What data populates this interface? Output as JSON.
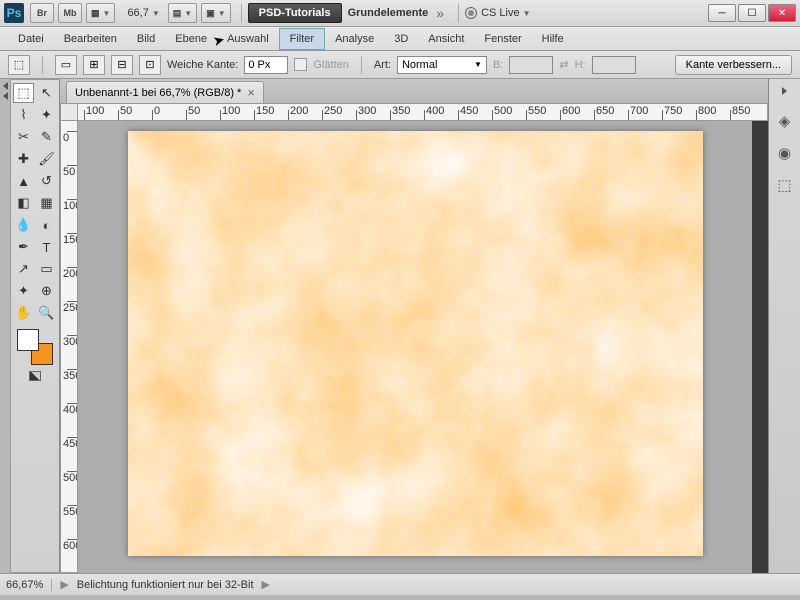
{
  "titlebar": {
    "app_br": "Br",
    "app_mb": "Mb",
    "zoom": "66,7",
    "psd_tutorials": "PSD-Tutorials",
    "workspace": "Grundelemente",
    "cslive": "CS Live"
  },
  "menubar": {
    "items": [
      "Datei",
      "Bearbeiten",
      "Bild",
      "Ebene",
      "Auswahl",
      "Filter",
      "Analyse",
      "3D",
      "Ansicht",
      "Fenster",
      "Hilfe"
    ],
    "active_index": 5
  },
  "optbar": {
    "weiche_kante_label": "Weiche Kante:",
    "weiche_kante_value": "0 Px",
    "glaetten": "Glätten",
    "art_label": "Art:",
    "art_value": "Normal",
    "b_label": "B:",
    "h_label": "H:",
    "kante_btn": "Kante verbessern..."
  },
  "document": {
    "tab_title": "Unbenannt-1 bei 66,7% (RGB/8) *"
  },
  "ruler": {
    "h_labels": [
      "100",
      "50",
      "0",
      "50",
      "100",
      "150",
      "200",
      "250",
      "300",
      "350",
      "400",
      "450",
      "500",
      "550",
      "600",
      "650",
      "700",
      "750",
      "800",
      "850"
    ],
    "v_labels": [
      "0",
      "50",
      "100",
      "150",
      "200",
      "250",
      "300",
      "350",
      "400",
      "450",
      "500",
      "550",
      "600"
    ]
  },
  "statusbar": {
    "zoom": "66,67%",
    "message": "Belichtung funktioniert nur bei 32-Bit"
  },
  "colors": {
    "fg": "#ffffff",
    "bg": "#f7941d"
  }
}
